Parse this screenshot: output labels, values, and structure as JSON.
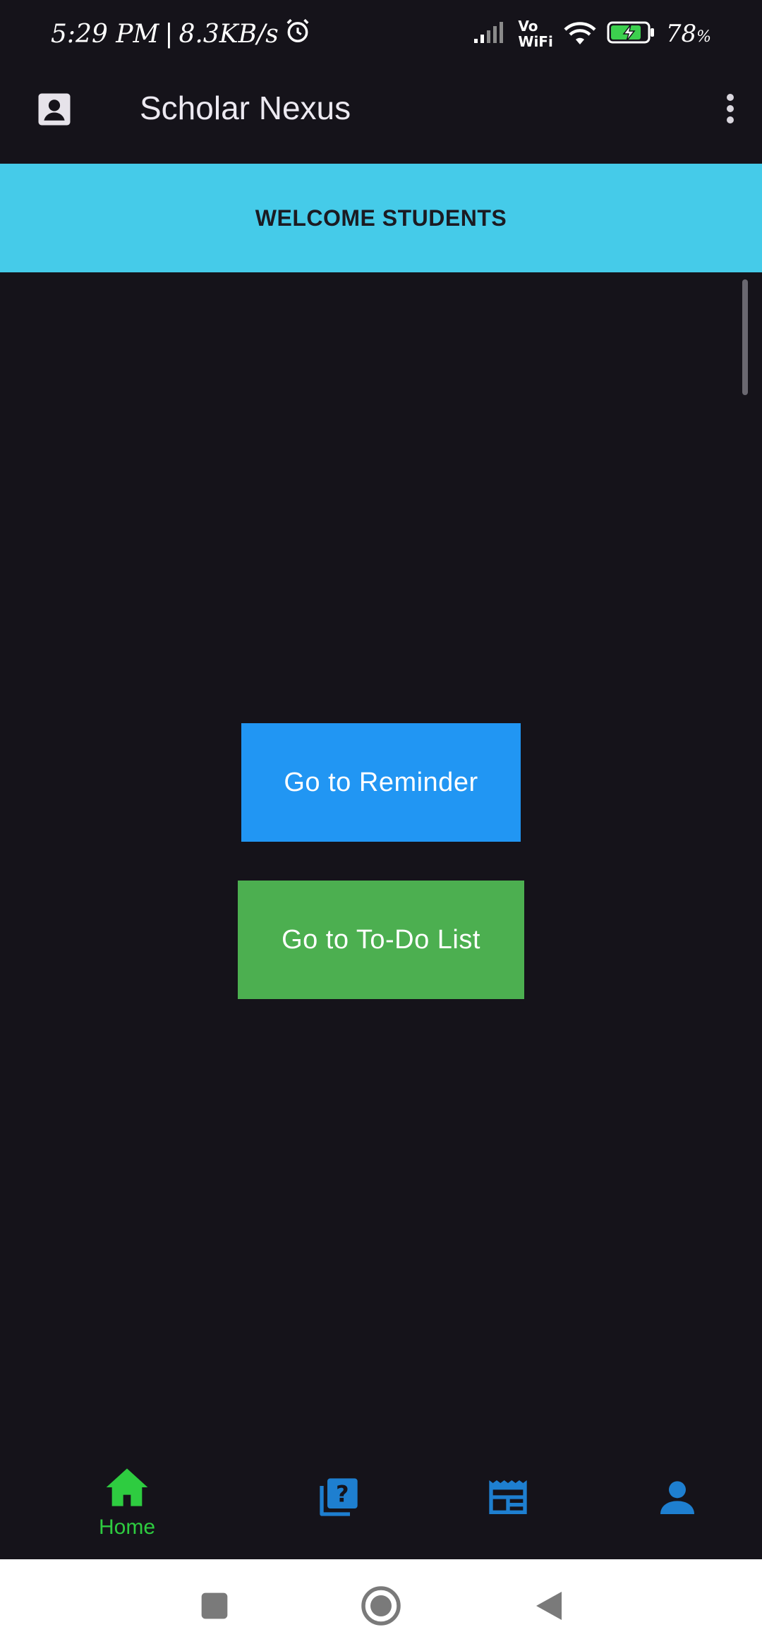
{
  "status_bar": {
    "time": "5:29 PM",
    "separator": "|",
    "net_speed": "8.3KB/s",
    "vowifi_top": "Vo",
    "vowifi_bottom": "WiFi",
    "battery_percent": "78",
    "battery_unit": "%"
  },
  "app_bar": {
    "title": "Scholar Nexus"
  },
  "banner": {
    "text": "WELCOME STUDENTS",
    "color": "#45cbe9"
  },
  "buttons": {
    "reminder_label": "Go to Reminder",
    "reminder_color": "#2196f3",
    "todo_label": "Go to To-Do List",
    "todo_color": "#4caf50"
  },
  "bottom_nav": {
    "items": [
      {
        "icon": "home-icon",
        "label": "Home",
        "active": true,
        "color": "#2ecc40"
      },
      {
        "icon": "quiz-icon",
        "label": "",
        "active": false,
        "color": "#1e7fd0"
      },
      {
        "icon": "newspaper-icon",
        "label": "",
        "active": false,
        "color": "#1e7fd0"
      },
      {
        "icon": "person-icon",
        "label": "",
        "active": false,
        "color": "#1e7fd0"
      }
    ]
  },
  "system_nav": {
    "buttons": [
      "recent-apps-icon",
      "home-circle-icon",
      "back-triangle-icon"
    ]
  }
}
